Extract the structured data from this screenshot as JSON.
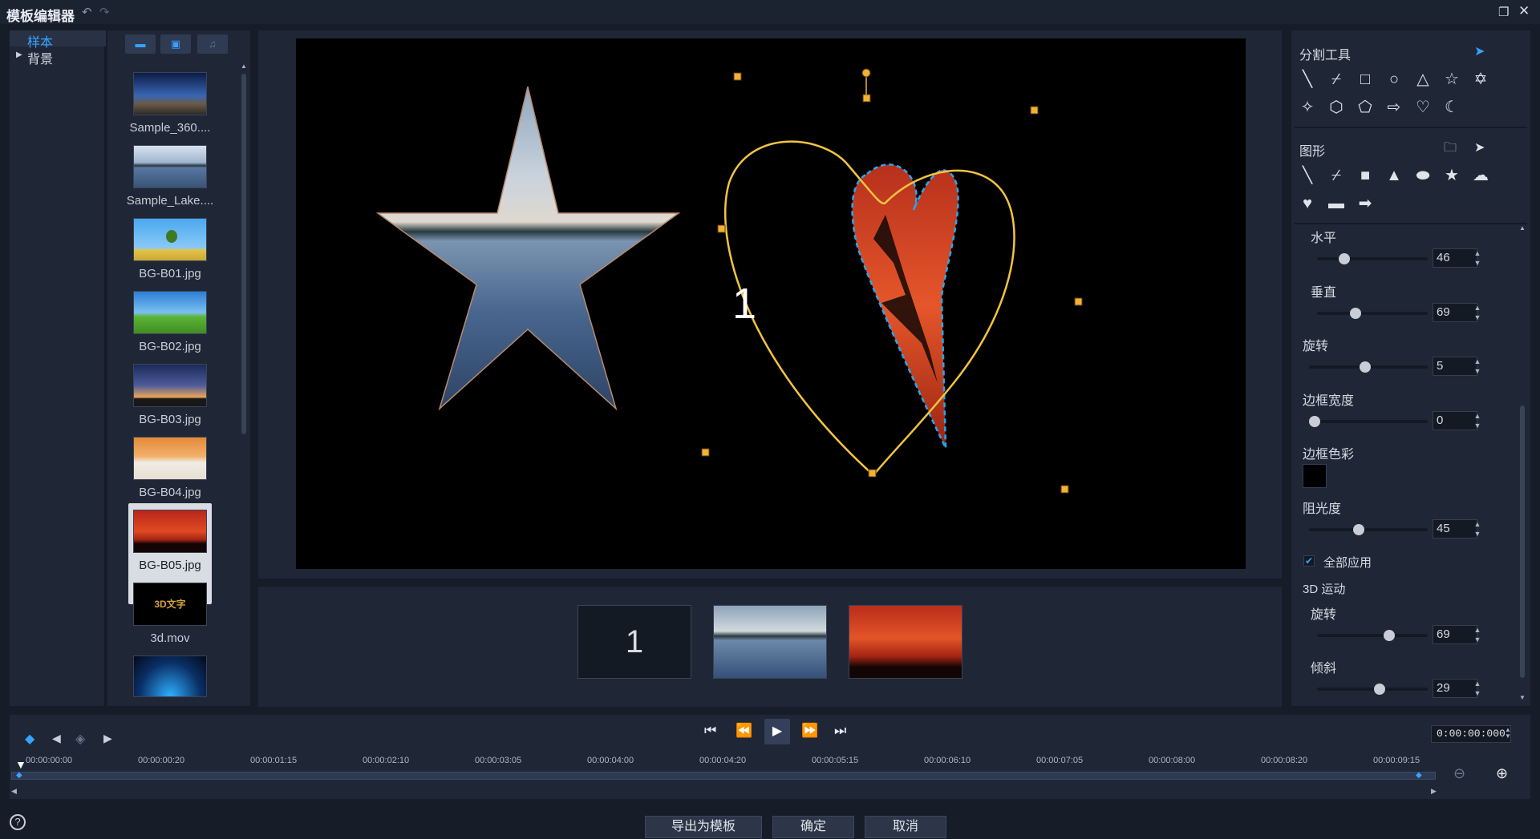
{
  "title_bar": {
    "title": "模板编辑器"
  },
  "categories": [
    {
      "label": "样本"
    },
    {
      "label": "背景"
    }
  ],
  "library": {
    "items": [
      {
        "label": "Sample_360...."
      },
      {
        "label": "Sample_Lake...."
      },
      {
        "label": "BG-B01.jpg"
      },
      {
        "label": "BG-B02.jpg"
      },
      {
        "label": "BG-B03.jpg"
      },
      {
        "label": "BG-B04.jpg"
      },
      {
        "label": "BG-B05.jpg"
      },
      {
        "label": "3d.mov"
      },
      {
        "label": ""
      }
    ],
    "thumb_3d_text": "3D文字",
    "selected_index": 6
  },
  "preview": {
    "text_object": "1"
  },
  "filmstrip": {
    "item1_text": "1"
  },
  "right_panel": {
    "split_tools_title": "分割工具",
    "shapes_title": "图形",
    "horizontal": {
      "label": "水平",
      "value": "46",
      "level": 0.22
    },
    "vertical": {
      "label": "垂直",
      "value": "69",
      "level": 0.33
    },
    "rotate": {
      "label": "旋转",
      "value": "5",
      "level": 0.47
    },
    "border_width": {
      "label": "边框宽度",
      "value": "0",
      "level": 0.0
    },
    "border_color": {
      "label": "边框色彩",
      "color": "#000000"
    },
    "opacity": {
      "label": "阻光度",
      "value": "45",
      "level": 0.41
    },
    "apply_all": {
      "label": "全部应用",
      "checked": true
    },
    "motion_3d": {
      "label": "3D 运动"
    },
    "rotate_3d": {
      "label": "旋转",
      "value": "69",
      "level": 0.67
    },
    "tilt_3d": {
      "label": "倾斜",
      "value": "29",
      "level": 0.57
    }
  },
  "timeline": {
    "timecode": "0:00:00:000",
    "ticks": [
      "00:00:00:00",
      "00:00:00:20",
      "00:00:01:15",
      "00:00:02:10",
      "00:00:03:05",
      "00:00:04:00",
      "00:00:04:20",
      "00:00:05:15",
      "00:00:06:10",
      "00:00:07:05",
      "00:00:08:00",
      "00:00:08:20",
      "00:00:09:15"
    ]
  },
  "buttons": {
    "export": "导出为模板",
    "ok": "确定",
    "cancel": "取消",
    "help": "?"
  },
  "colors": {
    "accent": "#36a3ff",
    "handle": "#f2b233",
    "selection_outline": "#f2c440",
    "split_outline": "#2ba6ee"
  }
}
